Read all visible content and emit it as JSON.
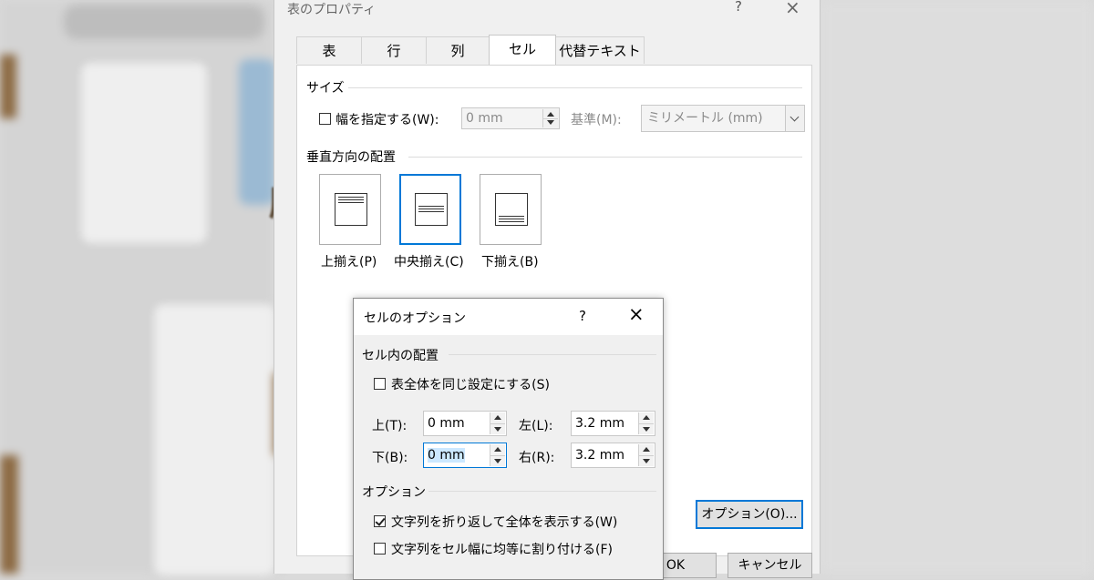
{
  "backdrop": {
    "text_fragment": "所"
  },
  "main_dialog": {
    "title": "表のプロパティ",
    "help_glyph": "?",
    "close_glyph": "×",
    "tabs": [
      {
        "label": "表"
      },
      {
        "label": "行"
      },
      {
        "label": "列"
      },
      {
        "label": "セル",
        "active": true
      },
      {
        "label": "代替テキスト"
      }
    ],
    "size_section": {
      "label": "サイズ",
      "width_checkbox_label": "幅を指定する(W):",
      "width_checked": false,
      "width_value": "0 mm",
      "basis_label": "基準(M):",
      "basis_value": "ミリメートル (mm)"
    },
    "valign_section": {
      "label": "垂直方向の配置",
      "options": [
        {
          "label": "上揃え(P)"
        },
        {
          "label": "中央揃え(C)",
          "selected": true
        },
        {
          "label": "下揃え(B)"
        }
      ]
    },
    "options_button": "オプション(O)...",
    "ok_button": "OK",
    "cancel_button": "キャンセル"
  },
  "cell_options_dialog": {
    "title": "セルのオプション",
    "help_glyph": "?",
    "close_glyph": "×",
    "margins_section": {
      "label": "セル内の配置",
      "same_as_table_label": "表全体を同じ設定にする(S)",
      "same_as_table_checked": false,
      "top_label": "上(T):",
      "top_value": "0 mm",
      "left_label": "左(L):",
      "left_value": "3.2 mm",
      "bottom_label": "下(B):",
      "bottom_value": "0 mm",
      "right_label": "右(R):",
      "right_value": "3.2 mm"
    },
    "options_section": {
      "label": "オプション",
      "wrap_text_label": "文字列を折り返して全体を表示する(W)",
      "wrap_text_checked": true,
      "fit_text_label": "文字列をセル幅に均等に割り付ける(F)",
      "fit_text_checked": false
    }
  },
  "colors": {
    "accent": "#0078d7",
    "dialog_bg": "#f0f0f0"
  }
}
